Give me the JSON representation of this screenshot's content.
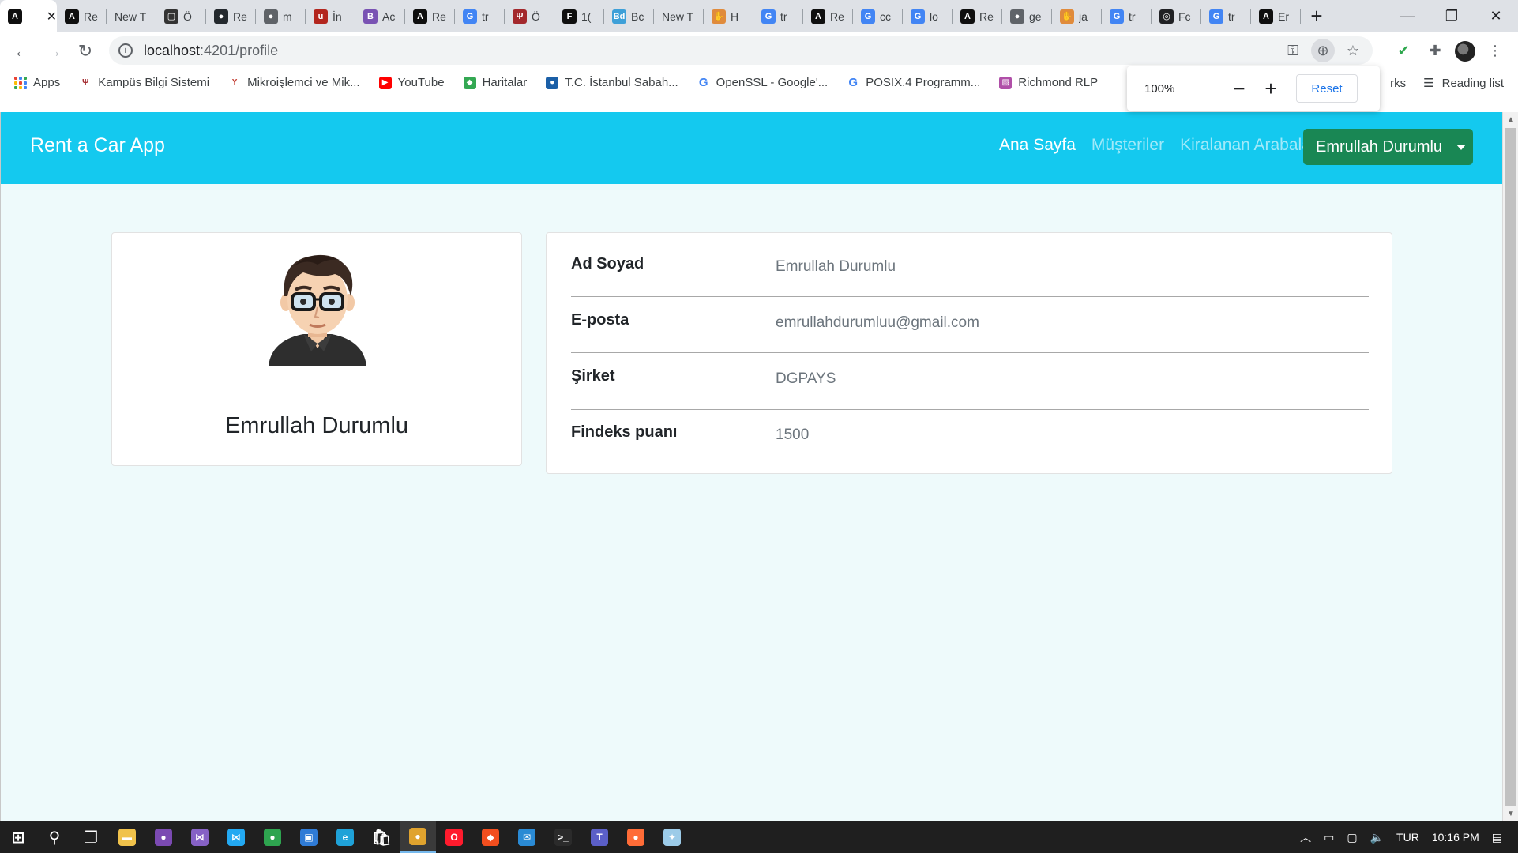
{
  "browser": {
    "tabs": [
      {
        "title": "",
        "favicon": "angular-icon",
        "color": "#0f0f0f",
        "glyph": "A",
        "active": true
      },
      {
        "title": "Re",
        "favicon": "angular-icon",
        "color": "#0f0f0f",
        "glyph": "A"
      },
      {
        "title": "New T",
        "favicon": "none",
        "color": "",
        "glyph": ""
      },
      {
        "title": "Ö",
        "favicon": "frame-icon",
        "color": "#333333",
        "glyph": "▢"
      },
      {
        "title": "Re",
        "favicon": "github-icon",
        "color": "#24292e",
        "glyph": "●"
      },
      {
        "title": "m",
        "favicon": "globe-icon",
        "color": "#5f6368",
        "glyph": "●"
      },
      {
        "title": "İn",
        "favicon": "udemy-icon",
        "color": "#b3261e",
        "glyph": "u"
      },
      {
        "title": "Ac",
        "favicon": "bootstrap-icon",
        "color": "#7952b3",
        "glyph": "B"
      },
      {
        "title": "Re",
        "favicon": "angular-icon",
        "color": "#0f0f0f",
        "glyph": "A"
      },
      {
        "title": "tr",
        "favicon": "google-icon",
        "color": "#4285f4",
        "glyph": "G"
      },
      {
        "title": "Ö",
        "favicon": "university-icon",
        "color": "#a3282c",
        "glyph": "Ψ"
      },
      {
        "title": "1(",
        "favicon": "f-icon",
        "color": "#0f0f0f",
        "glyph": "F"
      },
      {
        "title": "Bc",
        "favicon": "bd-icon",
        "color": "#3ea0d8",
        "glyph": "Bd"
      },
      {
        "title": "New T",
        "favicon": "none",
        "color": "",
        "glyph": ""
      },
      {
        "title": "H",
        "favicon": "hand-icon",
        "color": "#e08b3c",
        "glyph": "✋"
      },
      {
        "title": "tr",
        "favicon": "google-icon",
        "color": "#4285f4",
        "glyph": "G"
      },
      {
        "title": "Re",
        "favicon": "angular-icon",
        "color": "#0f0f0f",
        "glyph": "A"
      },
      {
        "title": "cc",
        "favicon": "google-icon",
        "color": "#4285f4",
        "glyph": "G"
      },
      {
        "title": "lo",
        "favicon": "google-icon",
        "color": "#4285f4",
        "glyph": "G"
      },
      {
        "title": "Re",
        "favicon": "angular-icon",
        "color": "#0f0f0f",
        "glyph": "A"
      },
      {
        "title": "ge",
        "favicon": "globe-icon",
        "color": "#5f6368",
        "glyph": "●"
      },
      {
        "title": "ja",
        "favicon": "hand-icon",
        "color": "#e08b3c",
        "glyph": "✋"
      },
      {
        "title": "tr",
        "favicon": "google-icon",
        "color": "#4285f4",
        "glyph": "G"
      },
      {
        "title": "Fc",
        "favicon": "openai-icon",
        "color": "#202124",
        "glyph": "◎"
      },
      {
        "title": "tr",
        "favicon": "google-icon",
        "color": "#4285f4",
        "glyph": "G"
      },
      {
        "title": "Er",
        "favicon": "angular-icon",
        "color": "#0f0f0f",
        "glyph": "A"
      }
    ],
    "url_host": "localhost",
    "url_rest": ":4201/profile",
    "bookmarks": [
      {
        "label": "Apps",
        "icon": "apps-grid-icon",
        "color": "#4285f4",
        "glyph": ""
      },
      {
        "label": "Kampüs Bilgi Sistemi",
        "icon": "university-icon",
        "color": "#a3282c",
        "glyph": "Ψ"
      },
      {
        "label": "Mikroişlemci ve Mik...",
        "icon": "y-icon",
        "color": "#c23a2f",
        "glyph": "Y"
      },
      {
        "label": "YouTube",
        "icon": "youtube-icon",
        "color": "#ff0000",
        "glyph": "▶"
      },
      {
        "label": "Haritalar",
        "icon": "maps-icon",
        "color": "#34a853",
        "glyph": "◆"
      },
      {
        "label": "T.C. İstanbul Sabah...",
        "icon": "otm-icon",
        "color": "#1b5fa7",
        "glyph": "●"
      },
      {
        "label": "OpenSSL - Google'...",
        "icon": "google-icon",
        "color": "#4285f4",
        "glyph": "G"
      },
      {
        "label": "POSIX.4 Programm...",
        "icon": "google-icon",
        "color": "#4285f4",
        "glyph": "G"
      },
      {
        "label": "Richmond RLP",
        "icon": "richmond-icon",
        "color": "#b04fa8",
        "glyph": "▨"
      }
    ],
    "bookmarks_right": {
      "partial": "rks",
      "reading_list": "Reading list"
    },
    "zoom_popup": {
      "percent": "100%",
      "minus": "−",
      "plus": "+",
      "reset": "Reset"
    }
  },
  "app": {
    "brand": "Rent a Car App",
    "nav": {
      "home": "Ana Sayfa",
      "customers": "Müşteriler",
      "rented_cars": "Kiralanan Arabalar",
      "user_menu": "Emrullah Durumlu"
    },
    "profile": {
      "name": "Emrullah Durumlu",
      "fields": [
        {
          "label": "Ad Soyad",
          "value": "Emrullah Durumlu"
        },
        {
          "label": "E-posta",
          "value": "emrullahdurumluu@gmail.com"
        },
        {
          "label": "Şirket",
          "value": "DGPAYS"
        },
        {
          "label": "Findeks puanı",
          "value": "1500"
        }
      ]
    },
    "colors": {
      "navbar": "#14c9ef",
      "user_button": "#198754",
      "page_bg": "#eefafb"
    }
  },
  "taskbar": {
    "items": [
      {
        "name": "start-icon",
        "color": "#ffffff",
        "glyph": "⊞"
      },
      {
        "name": "search-icon",
        "color": "#ffffff",
        "glyph": "⚲"
      },
      {
        "name": "task-view-icon",
        "color": "#ffffff",
        "glyph": "❐"
      },
      {
        "name": "file-explorer-icon",
        "color": "#f0c24b",
        "glyph": "▬"
      },
      {
        "name": "github-desktop-icon",
        "color": "#7b4ab2",
        "glyph": "●"
      },
      {
        "name": "visual-studio-icon",
        "color": "#8661c5",
        "glyph": "⋈"
      },
      {
        "name": "vscode-icon",
        "color": "#23a9f2",
        "glyph": "⋈"
      },
      {
        "name": "app-green-icon",
        "color": "#2ea44f",
        "glyph": "●"
      },
      {
        "name": "app-blue-icon",
        "color": "#2f7bd6",
        "glyph": "▣"
      },
      {
        "name": "edge-icon",
        "color": "#1fa2d8",
        "glyph": "e"
      },
      {
        "name": "store-icon",
        "color": "#ffffff",
        "glyph": "🛍"
      },
      {
        "name": "chrome-icon",
        "color": "#e0a32e",
        "glyph": "●",
        "active": true
      },
      {
        "name": "opera-icon",
        "color": "#ff1b2d",
        "glyph": "O"
      },
      {
        "name": "figma-icon",
        "color": "#f24e1e",
        "glyph": "◆"
      },
      {
        "name": "mail-icon",
        "color": "#2a8ad4",
        "glyph": "✉"
      },
      {
        "name": "terminal-icon",
        "color": "#2b2b2b",
        "glyph": ">_"
      },
      {
        "name": "teams-icon",
        "color": "#5b5fc7",
        "glyph": "T"
      },
      {
        "name": "postman-icon",
        "color": "#ff6c37",
        "glyph": "●"
      },
      {
        "name": "app-bird-icon",
        "color": "#9ccbe8",
        "glyph": "✦"
      }
    ],
    "tray": {
      "language": "TUR",
      "time": "10:16 PM"
    }
  }
}
